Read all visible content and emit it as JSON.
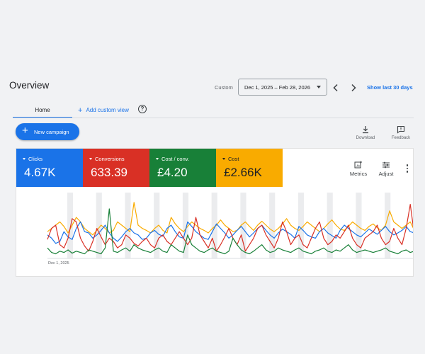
{
  "page": {
    "title": "Overview"
  },
  "date_range": {
    "label": "Custom",
    "value": "Dec 1, 2025 – Feb 28, 2026",
    "show_last_label": "Show last 30 days"
  },
  "tabs": [
    {
      "label": "Home",
      "active": true
    }
  ],
  "add_view_label": "Add custom view",
  "new_campaign_label": "New campaign",
  "toolbar": {
    "download_label": "Download",
    "feedback_label": "Feedback"
  },
  "metrics": [
    {
      "name": "Clicks",
      "value": "4.67K",
      "color": "#1a73e8"
    },
    {
      "name": "Conversions",
      "value": "633.39",
      "color": "#d93025"
    },
    {
      "name": "Cost / conv.",
      "value": "£4.20",
      "color": "#188038"
    },
    {
      "name": "Cost",
      "value": "£2.66K",
      "color": "#f9ab00"
    }
  ],
  "chart_controls": {
    "metrics_label": "Metrics",
    "adjust_label": "Adjust"
  },
  "chart_data": {
    "type": "line",
    "x_start_label": "Dec 1, 2025",
    "num_points": 90,
    "weekend_band_color": "#dadce0",
    "series": [
      {
        "color": "#1a73e8",
        "values": [
          0.35,
          0.3,
          0.22,
          0.25,
          0.4,
          0.32,
          0.28,
          0.45,
          0.55,
          0.4,
          0.38,
          0.3,
          0.35,
          0.42,
          0.5,
          0.38,
          0.3,
          0.25,
          0.32,
          0.4,
          0.45,
          0.38,
          0.35,
          0.28,
          0.3,
          0.38,
          0.42,
          0.36,
          0.33,
          0.45,
          0.5,
          0.4,
          0.32,
          0.3,
          0.55,
          0.48,
          0.4,
          0.35,
          0.3,
          0.28,
          0.4,
          0.52,
          0.45,
          0.38,
          0.3,
          0.35,
          0.42,
          0.48,
          0.4,
          0.32,
          0.38,
          0.45,
          0.5,
          0.42,
          0.35,
          0.3,
          0.38,
          0.44,
          0.4,
          0.36,
          0.3,
          0.48,
          0.42,
          0.35,
          0.32,
          0.3,
          0.4,
          0.45,
          0.38,
          0.34,
          0.3,
          0.42,
          0.5,
          0.45,
          0.4,
          0.35,
          0.32,
          0.38,
          0.44,
          0.4,
          0.36,
          0.42,
          0.48,
          0.4,
          0.35,
          0.38,
          0.42,
          0.48,
          0.4,
          0.38
        ]
      },
      {
        "color": "#d93025",
        "values": [
          0.28,
          0.45,
          0.5,
          0.2,
          0.15,
          0.3,
          0.6,
          0.55,
          0.3,
          0.18,
          0.1,
          0.25,
          0.45,
          0.32,
          0.2,
          0.3,
          0.25,
          0.15,
          0.2,
          0.35,
          0.3,
          0.22,
          0.18,
          0.25,
          0.3,
          0.2,
          0.15,
          0.3,
          0.35,
          0.25,
          0.2,
          0.3,
          0.4,
          0.3,
          0.2,
          0.3,
          0.62,
          0.35,
          0.25,
          0.15,
          0.3,
          0.1,
          0.2,
          0.32,
          0.45,
          0.3,
          0.2,
          0.35,
          0.1,
          0.2,
          0.3,
          0.45,
          0.5,
          0.35,
          0.25,
          0.15,
          0.3,
          0.55,
          0.4,
          0.2,
          0.3,
          0.35,
          0.2,
          0.15,
          0.3,
          0.45,
          0.55,
          0.3,
          0.2,
          0.25,
          0.35,
          0.3,
          0.4,
          0.5,
          0.3,
          0.2,
          0.15,
          0.3,
          0.35,
          0.4,
          0.5,
          0.3,
          0.2,
          0.25,
          0.45,
          0.3,
          0.2,
          0.45,
          0.82,
          0.35
        ]
      },
      {
        "color": "#188038",
        "values": [
          0.15,
          0.08,
          0.06,
          0.1,
          0.08,
          0.12,
          0.07,
          0.1,
          0.08,
          0.06,
          0.12,
          0.1,
          0.08,
          0.06,
          0.15,
          0.75,
          0.1,
          0.08,
          0.12,
          0.15,
          0.1,
          0.2,
          0.15,
          0.12,
          0.1,
          0.08,
          0.12,
          0.15,
          0.1,
          0.08,
          0.2,
          0.15,
          0.1,
          0.08,
          0.35,
          0.2,
          0.15,
          0.1,
          0.08,
          0.12,
          0.15,
          0.1,
          0.08,
          0.06,
          0.1,
          0.3,
          0.2,
          0.12,
          0.08,
          0.06,
          0.1,
          0.15,
          0.2,
          0.12,
          0.08,
          0.1,
          0.15,
          0.12,
          0.1,
          0.08,
          0.12,
          0.15,
          0.1,
          0.08,
          0.06,
          0.1,
          0.12,
          0.15,
          0.1,
          0.08,
          0.12,
          0.1,
          0.15,
          0.2,
          0.12,
          0.08,
          0.1,
          0.12,
          0.1,
          0.08,
          0.1,
          0.12,
          0.15,
          0.1,
          0.08,
          0.06,
          0.1,
          0.12,
          0.08,
          0.1
        ]
      },
      {
        "color": "#f9ab00",
        "values": [
          0.4,
          0.45,
          0.5,
          0.55,
          0.48,
          0.38,
          0.5,
          0.62,
          0.55,
          0.45,
          0.4,
          0.35,
          0.42,
          0.5,
          0.45,
          0.38,
          0.42,
          0.55,
          0.5,
          0.45,
          0.4,
          0.85,
          0.5,
          0.45,
          0.42,
          0.38,
          0.45,
          0.5,
          0.42,
          0.38,
          0.62,
          0.52,
          0.45,
          0.4,
          0.48,
          0.55,
          0.5,
          0.45,
          0.42,
          0.38,
          0.45,
          0.5,
          0.58,
          0.5,
          0.45,
          0.4,
          0.42,
          0.5,
          0.55,
          0.48,
          0.42,
          0.5,
          0.56,
          0.5,
          0.44,
          0.4,
          0.45,
          0.52,
          0.6,
          0.5,
          0.45,
          0.42,
          0.48,
          0.55,
          0.5,
          0.45,
          0.4,
          0.45,
          0.52,
          0.58,
          0.5,
          0.44,
          0.42,
          0.48,
          0.55,
          0.5,
          0.45,
          0.42,
          0.48,
          0.52,
          0.46,
          0.42,
          0.5,
          0.72,
          0.55,
          0.5,
          0.45,
          0.5,
          0.55,
          0.42
        ]
      }
    ]
  }
}
